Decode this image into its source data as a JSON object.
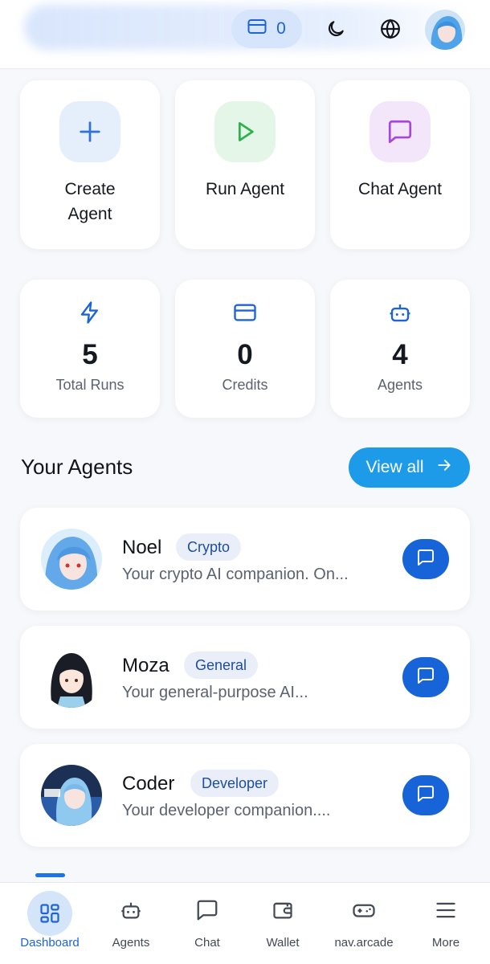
{
  "header": {
    "credits_value": "0",
    "icons": [
      "credit-card-icon",
      "moon-icon",
      "globe-icon",
      "user-avatar"
    ]
  },
  "actions": [
    {
      "label": "Create Agent",
      "icon": "plus-icon",
      "icon_bg": "#e5eefb",
      "icon_color": "#2f73d9"
    },
    {
      "label": "Run Agent",
      "icon": "play-icon",
      "icon_bg": "#e3f6e7",
      "icon_color": "#29b34a"
    },
    {
      "label": "Chat Agent",
      "icon": "message-square-icon",
      "icon_bg": "#f3e6fb",
      "icon_color": "#a448d8"
    }
  ],
  "stats": [
    {
      "value": "5",
      "label": "Total Runs",
      "icon": "zap-icon"
    },
    {
      "value": "0",
      "label": "Credits",
      "icon": "credit-card-icon"
    },
    {
      "value": "4",
      "label": "Agents",
      "icon": "bot-icon"
    }
  ],
  "section": {
    "title": "Your Agents",
    "view_all_label": "View all"
  },
  "agents": [
    {
      "name": "Noel",
      "tag": "Crypto",
      "description": "Your crypto AI companion. On..."
    },
    {
      "name": "Moza",
      "tag": "General",
      "description": "Your general-purpose AI..."
    },
    {
      "name": "Coder",
      "tag": "Developer",
      "description": "Your developer companion...."
    }
  ],
  "nav": [
    {
      "label": "Dashboard",
      "icon": "grid-icon",
      "active": true
    },
    {
      "label": "Agents",
      "icon": "bot-icon",
      "active": false
    },
    {
      "label": "Chat",
      "icon": "message-square-icon",
      "active": false
    },
    {
      "label": "Wallet",
      "icon": "wallet-icon",
      "active": false
    },
    {
      "label": "nav.arcade",
      "icon": "gamepad-icon",
      "active": false
    },
    {
      "label": "More",
      "icon": "menu-icon",
      "active": false
    }
  ],
  "colors": {
    "accent": "#1d64d8",
    "view_all_bg": "#1d9ae8",
    "chat_button_bg": "#1763d8",
    "tag_bg": "#e9eef8"
  }
}
